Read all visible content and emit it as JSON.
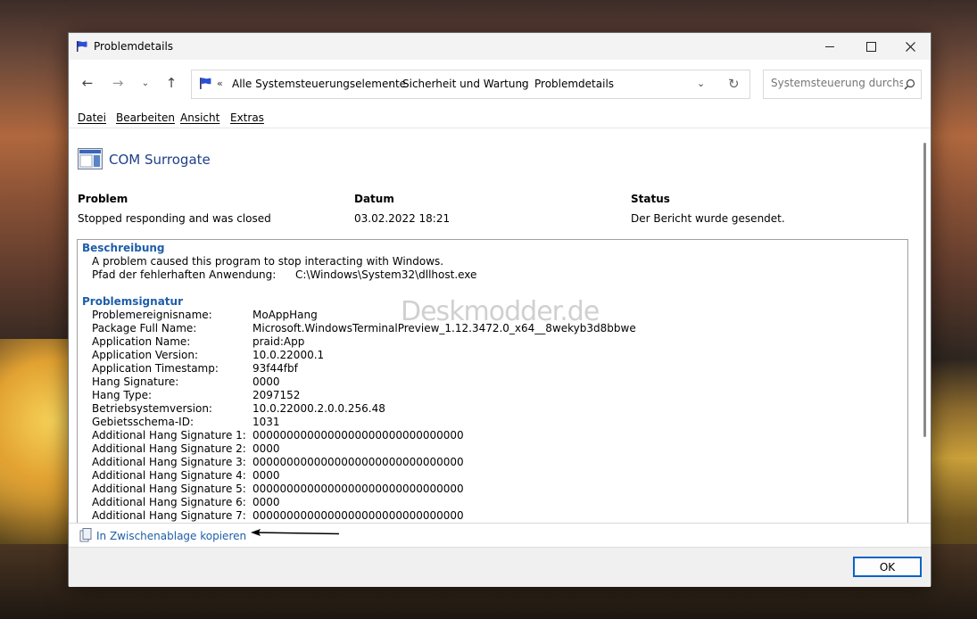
{
  "window": {
    "title": "Problemdetails",
    "controls": {
      "minimize_icon": "minimize-icon",
      "maximize_icon": "maximize-icon",
      "close_icon": "close-icon"
    }
  },
  "nav": {
    "breadcrumb_overflow": "«",
    "breadcrumbs": [
      "Alle Systemsteuerungselemente",
      "Sicherheit und Wartung",
      "Problemdetails"
    ],
    "search_placeholder": "Systemsteuerung durchs..."
  },
  "menu": [
    "Datei",
    "Bearbeiten",
    "Ansicht",
    "Extras"
  ],
  "app": {
    "name": "COM Surrogate"
  },
  "summary": {
    "problem_label": "Problem",
    "problem_value": "Stopped responding and was closed",
    "date_label": "Datum",
    "date_value": "03.02.2022 18:21",
    "status_label": "Status",
    "status_value": "Der Bericht wurde gesendet."
  },
  "description": {
    "title": "Beschreibung",
    "text": "A problem caused this program to stop interacting with Windows.",
    "path_label": "Pfad der fehlerhaften Anwendung:",
    "path_value": "C:\\Windows\\System32\\dllhost.exe"
  },
  "signature": {
    "title": "Problemsignatur",
    "rows": [
      {
        "key": "Problemereignisname:",
        "value": "MoAppHang"
      },
      {
        "key": "Package Full Name:",
        "value": "Microsoft.WindowsTerminalPreview_1.12.3472.0_x64__8wekyb3d8bbwe"
      },
      {
        "key": "Application Name:",
        "value": "praid:App"
      },
      {
        "key": "Application Version:",
        "value": "10.0.22000.1"
      },
      {
        "key": "Application Timestamp:",
        "value": "93f44fbf"
      },
      {
        "key": "Hang Signature:",
        "value": "0000"
      },
      {
        "key": "Hang Type:",
        "value": "2097152"
      },
      {
        "key": "Betriebsystemversion:",
        "value": "10.0.22000.2.0.0.256.48"
      },
      {
        "key": "Gebietsschema-ID:",
        "value": "1031"
      },
      {
        "key": "Additional Hang Signature 1:",
        "value": "0000000000000000000000000000000"
      },
      {
        "key": "Additional Hang Signature 2:",
        "value": "0000"
      },
      {
        "key": "Additional Hang Signature 3:",
        "value": "0000000000000000000000000000000"
      },
      {
        "key": "Additional Hang Signature 4:",
        "value": "0000"
      },
      {
        "key": "Additional Hang Signature 5:",
        "value": "0000000000000000000000000000000"
      },
      {
        "key": "Additional Hang Signature 6:",
        "value": "0000"
      },
      {
        "key": "Additional Hang Signature 7:",
        "value": "0000000000000000000000000000000"
      }
    ]
  },
  "watermark": "Deskmodder.de",
  "footer": {
    "copy_label": "In Zwischenablage kopieren",
    "ok_label": "OK"
  },
  "colors": {
    "link": "#1e5ea8",
    "title": "#1e3f8a",
    "accent": "#0a64c8"
  }
}
